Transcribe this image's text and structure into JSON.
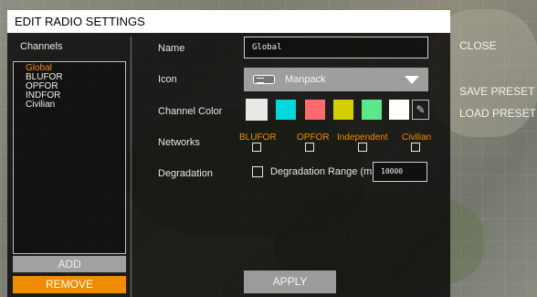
{
  "dialog": {
    "title": "EDIT RADIO SETTINGS"
  },
  "channels": {
    "header": "Channels",
    "items": [
      {
        "label": "Global",
        "selected": true
      },
      {
        "label": "BLUFOR",
        "selected": false
      },
      {
        "label": "OPFOR",
        "selected": false
      },
      {
        "label": "INDFOR",
        "selected": false
      },
      {
        "label": "Civilian",
        "selected": false
      }
    ],
    "add_label": "ADD",
    "remove_label": "REMOVE"
  },
  "form": {
    "name_label": "Name",
    "name_value": "Global",
    "icon_label": "Icon",
    "icon_value": "Manpack",
    "icon_name": "radio-manpack-icon",
    "color_label": "Channel Color",
    "colors": [
      "#e8e8e8",
      "#00d8e0",
      "#ff6b6b",
      "#d4cf00",
      "#5ce88a",
      "#ffffff"
    ],
    "networks_label": "Networks",
    "networks": [
      {
        "label": "BLUFOR",
        "checked": false
      },
      {
        "label": "OPFOR",
        "checked": false
      },
      {
        "label": "Independent",
        "checked": false
      },
      {
        "label": "Civilian",
        "checked": false
      }
    ],
    "degradation_label": "Degradation",
    "degradation_range_label": "Degradation Range (m",
    "degradation_value": "10000",
    "apply_label": "APPLY"
  },
  "side_actions": {
    "close_label": "CLOSE",
    "save_preset_label": "SAVE PRESET",
    "load_preset_label": "LOAD PRESET"
  },
  "accent_color": "#f08c00"
}
